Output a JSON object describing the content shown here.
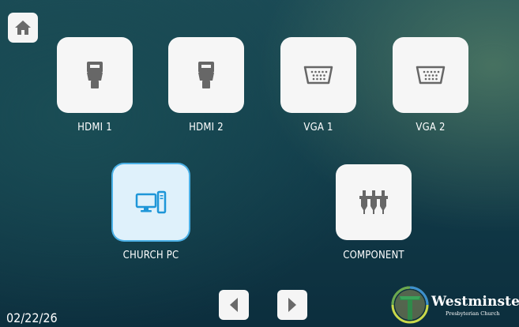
{
  "home": {
    "icon": "home-icon"
  },
  "sources": [
    {
      "label": "HDMI 1",
      "icon": "hdmi-connector-icon",
      "selected": false
    },
    {
      "label": "HDMI 2",
      "icon": "hdmi-connector-icon",
      "selected": false
    },
    {
      "label": "VGA 1",
      "icon": "vga-connector-icon",
      "selected": false
    },
    {
      "label": "VGA 2",
      "icon": "vga-connector-icon",
      "selected": false
    },
    {
      "label": "CHURCH PC",
      "icon": "desktop-computer-icon",
      "selected": true
    },
    {
      "label": "COMPONENT",
      "icon": "component-connector-icon",
      "selected": false
    }
  ],
  "footer": {
    "date": "02/22/26",
    "prev_icon": "triangle-left-icon",
    "next_icon": "triangle-right-icon"
  },
  "logo": {
    "title": "Westminster",
    "subtitle": "Presbyterian Church"
  },
  "colors": {
    "tile": "#f6f6f6",
    "selected_tile": "#dff1fb",
    "selected_border": "#4ab0e6",
    "icon_gray": "#666666",
    "icon_blue": "#1e96d8"
  }
}
